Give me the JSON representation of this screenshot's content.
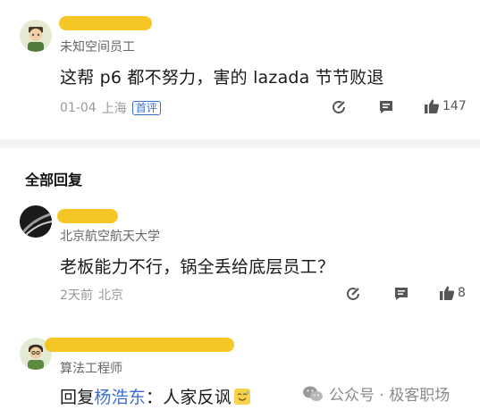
{
  "comments": [
    {
      "subtitle": "未知空间员工",
      "text": "这帮 p6 都不努力，害的 lazada 节节败退",
      "date": "01-04",
      "location": "上海",
      "badge": "首评",
      "likes": "147"
    }
  ],
  "section_title": "全部回复",
  "replies": [
    {
      "subtitle": "北京航空航天大学",
      "text": "老板能力不行，锅全丢给底层员工？",
      "date": "2天前",
      "location": "北京",
      "likes": "8"
    },
    {
      "subtitle": "算法工程师",
      "reply_prefix": "回复",
      "reply_to": "杨浩东",
      "text": "：人家反讽"
    }
  ],
  "watermark": {
    "text": "公众号 · 极客职场",
    "icon": "wechat-icon"
  },
  "icons": [
    "share-icon",
    "comment-icon",
    "thumbs-up-icon"
  ],
  "colors": {
    "accent": "#3b6fd1",
    "redaction": "#f6c21a"
  }
}
